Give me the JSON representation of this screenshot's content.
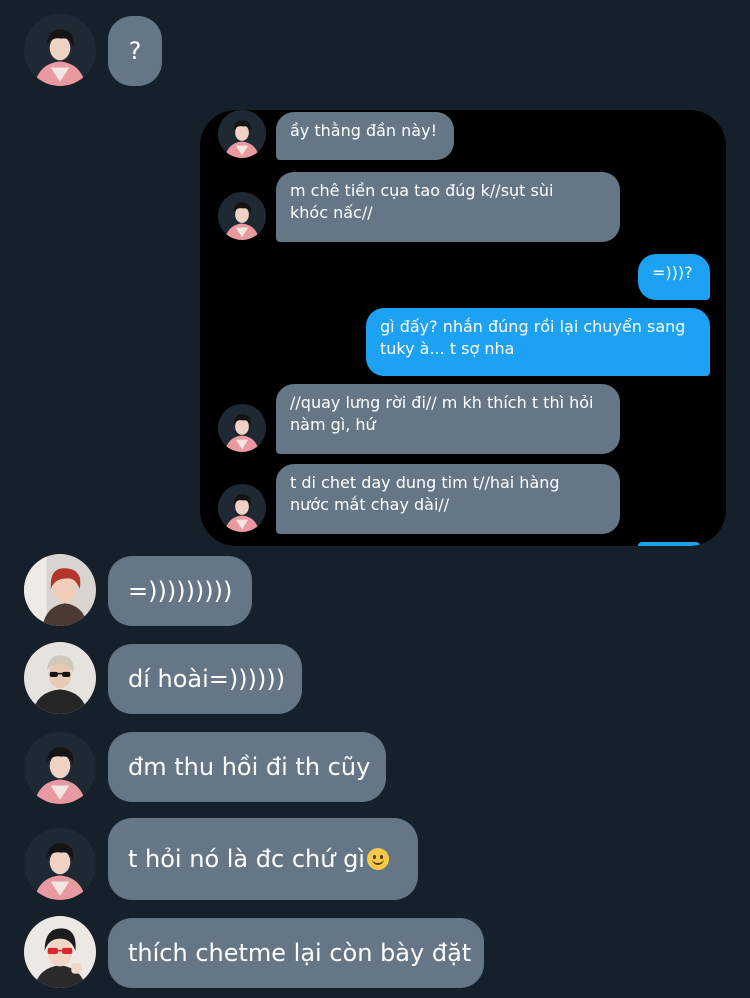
{
  "messages": [
    {
      "avatar": "avatar-pink-jacket",
      "text": "?"
    },
    {
      "avatar": "avatar-red-hair",
      "text": "=)))))))))"
    },
    {
      "avatar": "avatar-sunglasses",
      "text": "dí hoài=))))))"
    },
    {
      "avatar": "avatar-pink-jacket",
      "text": "đm thu hồi đi th cũy"
    },
    {
      "avatar": "avatar-pink-jacket",
      "text": "t hỏi nó là đc chứ gì",
      "emoji": "slightly-smiling-face-icon"
    },
    {
      "avatar": "avatar-red-glasses",
      "text": "thích chetme lại còn bày đặt"
    }
  ],
  "screenshot": {
    "messages": [
      {
        "side": "in",
        "line1": "ầy thằng đần này!"
      },
      {
        "side": "in",
        "line1": "m chê tiền cụa tao đúg k//sụt sùi",
        "line2": "khóc nấc//"
      },
      {
        "side": "out",
        "line1": "=)))?"
      },
      {
        "side": "out",
        "line1": "gì đấy? nhắn đúng rồi lại chuyển sang",
        "line2": "tuky à... t sợ nha"
      },
      {
        "side": "in",
        "line1": "//quay lưng rời đi// m kh thích t thì hỏi",
        "line2": "nàm gì, hứ"
      },
      {
        "side": "in",
        "line1": "t di chet day dung tim t//hai hàng",
        "line2": "nước mắt chay dài//"
      }
    ]
  },
  "colors": {
    "background": "#15202b",
    "incoming_bubble": "#657786",
    "outgoing_bubble": "#1da1f2",
    "embedded_bg": "#000000"
  }
}
